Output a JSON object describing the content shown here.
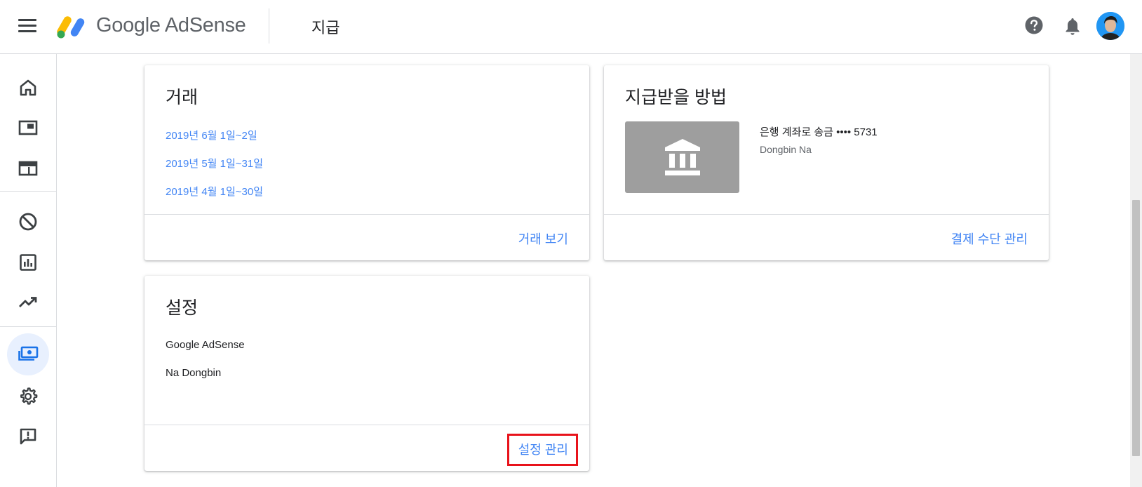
{
  "header": {
    "brand": "Google AdSense",
    "page_title": "지급",
    "icons": [
      "menu-icon",
      "help-icon",
      "notifications-icon",
      "avatar"
    ]
  },
  "sidebar": {
    "items": [
      {
        "name": "home",
        "icon": "home-icon",
        "active": false
      },
      {
        "name": "sites",
        "icon": "sites-icon",
        "active": false
      },
      {
        "name": "ads",
        "icon": "ads-icon",
        "active": false
      },
      {
        "name": "blocking-controls",
        "icon": "block-icon",
        "active": false
      },
      {
        "name": "reports",
        "icon": "reports-icon",
        "active": false
      },
      {
        "name": "optimization",
        "icon": "trending-icon",
        "active": false
      },
      {
        "name": "payments",
        "icon": "payments-icon",
        "active": true
      },
      {
        "name": "settings",
        "icon": "gear-icon",
        "active": false
      },
      {
        "name": "feedback",
        "icon": "feedback-icon",
        "active": false
      }
    ]
  },
  "transactions": {
    "title": "거래",
    "items": [
      "2019년 6월 1일~2일",
      "2019년 5월 1일~31일",
      "2019년 4월 1일~30일"
    ],
    "footer_link": "거래 보기"
  },
  "payment_method": {
    "title": "지급받을 방법",
    "method": "은행 계좌로 송금 •••• 5731",
    "account_name": "Dongbin Na",
    "image_icon": "bank-icon",
    "footer_link": "결제 수단 관리"
  },
  "settings_card": {
    "title": "설정",
    "lines": [
      "Google AdSense",
      "Na Dongbin"
    ],
    "footer_link": "설정 관리"
  },
  "colors": {
    "link": "#4285f4",
    "highlight": "#e8131b",
    "active_bg": "#e8f0fe",
    "active_icon": "#1a73e8"
  }
}
